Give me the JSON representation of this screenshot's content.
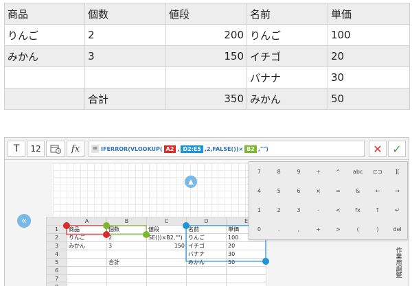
{
  "result_table": {
    "rows": [
      [
        "商品",
        "個数",
        "値段",
        "名前",
        "単価"
      ],
      [
        "りんご",
        "2",
        "200",
        "りんご",
        "100"
      ],
      [
        "みかん",
        "3",
        "150",
        "イチゴ",
        "20"
      ],
      [
        "",
        "",
        "",
        "バナナ",
        "30"
      ],
      [
        "",
        "合計",
        "350",
        "みかん",
        "50"
      ]
    ]
  },
  "toolbar": {
    "text_icon": "T",
    "font_size": "12",
    "calendar_icon": "calendar-clock-icon",
    "fx_label": "fx",
    "formula_eq": "=",
    "formula_prefix": "IFERROR(VLOOKUP(",
    "formula_ref1": "A2",
    "formula_sep1": ",",
    "formula_ref2": "D2:E5",
    "formula_mid": ",2,FALSE())×",
    "formula_ref3": "B2",
    "formula_suffix": ",\"\")",
    "cancel_glyph": "✕",
    "ok_glyph": "✓"
  },
  "colors": {
    "red": "#d62b2b",
    "blue": "#1e93d6",
    "green": "#7cb72b"
  },
  "nav": {
    "left_glyph": "«",
    "up_glyph": "▲"
  },
  "grid": {
    "columns": [
      "A",
      "B",
      "C",
      "D",
      "E"
    ],
    "rows": [
      {
        "n": "1",
        "cells": [
          "商品",
          "個数",
          "値段",
          "名前",
          "単価"
        ]
      },
      {
        "n": "2",
        "cells": [
          "りんご",
          "2",
          "SE())×B2,\"\")",
          "りんご",
          "100"
        ]
      },
      {
        "n": "3",
        "cells": [
          "みかん",
          "3",
          "150",
          "イチゴ",
          "20"
        ]
      },
      {
        "n": "4",
        "cells": [
          "",
          "",
          "",
          "バナナ",
          "30"
        ]
      },
      {
        "n": "5",
        "cells": [
          "",
          "合計",
          "",
          "みかん",
          "50"
        ]
      },
      {
        "n": "6",
        "cells": [
          "",
          "",
          "",
          "",
          ""
        ]
      },
      {
        "n": "7",
        "cells": [
          "",
          "",
          "",
          "",
          ""
        ]
      },
      {
        "n": "8",
        "cells": [
          "",
          "",
          "",
          "",
          ""
        ]
      }
    ]
  },
  "keypad": {
    "keys": [
      "7",
      "8",
      "9",
      "÷",
      "^",
      "abc",
      "⊏⊐",
      "][",
      "4",
      "5",
      "6",
      "×",
      "=",
      "&",
      "←",
      "→",
      "1",
      "2",
      "3",
      "-",
      "<",
      "fx",
      "↑",
      "↵",
      "0",
      ".",
      ",",
      "+",
      ">",
      "(",
      ")",
      "del"
    ]
  },
  "side_label": "作業用調整"
}
